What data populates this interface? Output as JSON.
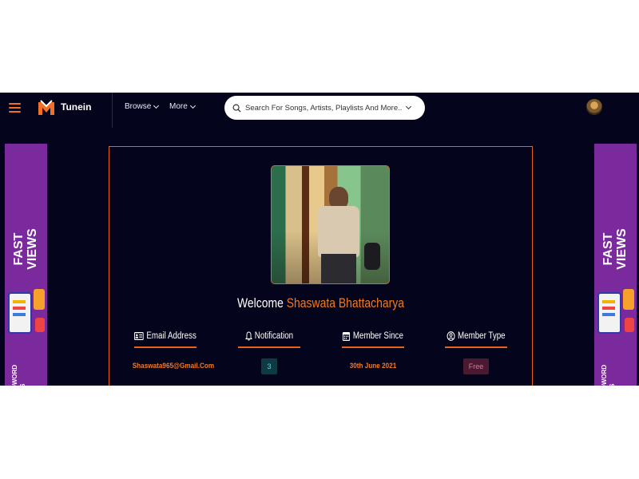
{
  "header": {
    "brand": "Tunein",
    "nav": [
      {
        "label": "Browse"
      },
      {
        "label": "More"
      }
    ],
    "search": {
      "placeholder": "Search For Songs, Artists, Playlists And More.."
    }
  },
  "ads": {
    "left": {
      "title": "FAST\nVIEWS",
      "subtitle": "E ADWORD\nIEWS"
    },
    "right": {
      "title": "FAST\nVIEWS",
      "subtitle": "E ADWORD\nIEWS"
    }
  },
  "profile": {
    "welcome_prefix": "Welcome",
    "name": "Shaswata Bhattacharya",
    "fields": [
      {
        "label": "Email Address",
        "value": "Shaswata965@Gmail.Com",
        "icon": "id-card-icon"
      },
      {
        "label": "Notification",
        "value": "3",
        "icon": "bell-icon"
      },
      {
        "label": "Member Since",
        "value": "30th June 2021",
        "icon": "calendar-icon"
      },
      {
        "label": "Member Type",
        "value": "Free",
        "icon": "user-circle-icon"
      }
    ]
  },
  "colors": {
    "background": "#04051c",
    "accent": "#e8621c",
    "ad_background": "#7a2a9c"
  }
}
